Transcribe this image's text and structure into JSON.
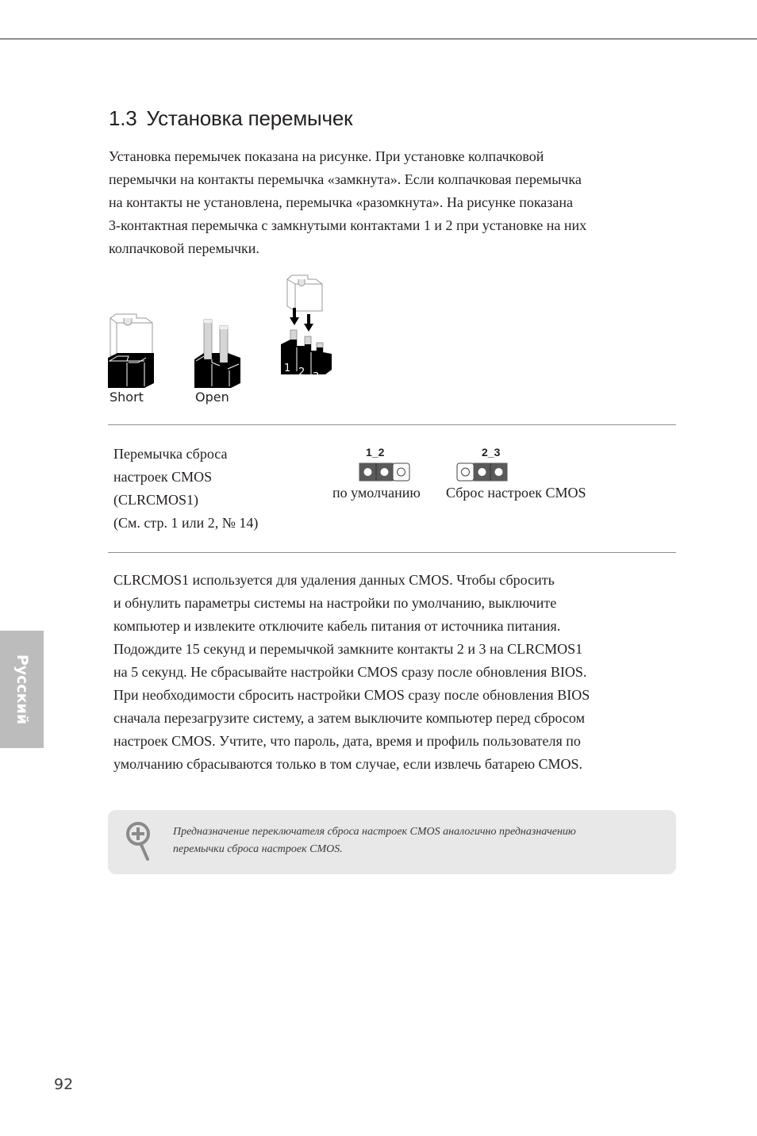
{
  "section": {
    "number": "1.3",
    "title": "Установка перемычек"
  },
  "intro_lines": [
    "Установка перемычек показана на рисунке. При установке колпачковой",
    "перемычки на контакты перемычка «замкнута». Если колпачковая перемычка",
    "на контакты не установлена, перемычка «разомкнута». На рисунке показана",
    "3-контактная перемычка с замкнутыми контактами 1 и 2 при установке на них",
    "колпачковой перемычки."
  ],
  "figure": {
    "short_label": "Short",
    "open_label": "Open",
    "pin_numbers": [
      "1",
      "2",
      "3"
    ]
  },
  "jumper": {
    "description_lines": [
      "Перемычка сброса",
      "настроек CMOS",
      "(CLRCMOS1)",
      "(См. стр. 1 или 2, № 14)"
    ],
    "default_setting": {
      "pins": "1_2",
      "caption": "по умолчанию",
      "closed": [
        true,
        true,
        false
      ]
    },
    "clear_setting": {
      "pins": "2_3",
      "caption": "Сброс настроек CMOS",
      "closed": [
        false,
        true,
        true
      ]
    }
  },
  "body_lines": [
    "CLRCMOS1 используется для удаления данных CMOS. Чтобы сбросить",
    "и обнулить параметры системы на настройки по умолчанию, выключите",
    "компьютер и извлеките отключите кабель питания от источника питания.",
    "Подождите 15 секунд и перемычкой замкните контакты 2 и 3 на CLRCMOS1",
    "на 5 секунд. Не сбрасывайте настройки CMOS сразу после обновления BIOS.",
    "При необходимости сбросить настройки CMOS сразу после обновления BIOS",
    "сначала перезагрузите систему, а затем выключите компьютер перед сбросом",
    "настроек CMOS. Учтите, что пароль, дата, время и профиль пользователя по",
    "умолчанию сбрасываются только в том случае, если извлечь батарею CMOS."
  ],
  "note": {
    "icon": "magnifier-plus-icon",
    "lines": [
      "Предназначение переключателя сброса настроек CMOS аналогично предназначению",
      "перемычки сброса настроек CMOS."
    ]
  },
  "side_tab": {
    "label": "Русский"
  },
  "page_number": "92"
}
